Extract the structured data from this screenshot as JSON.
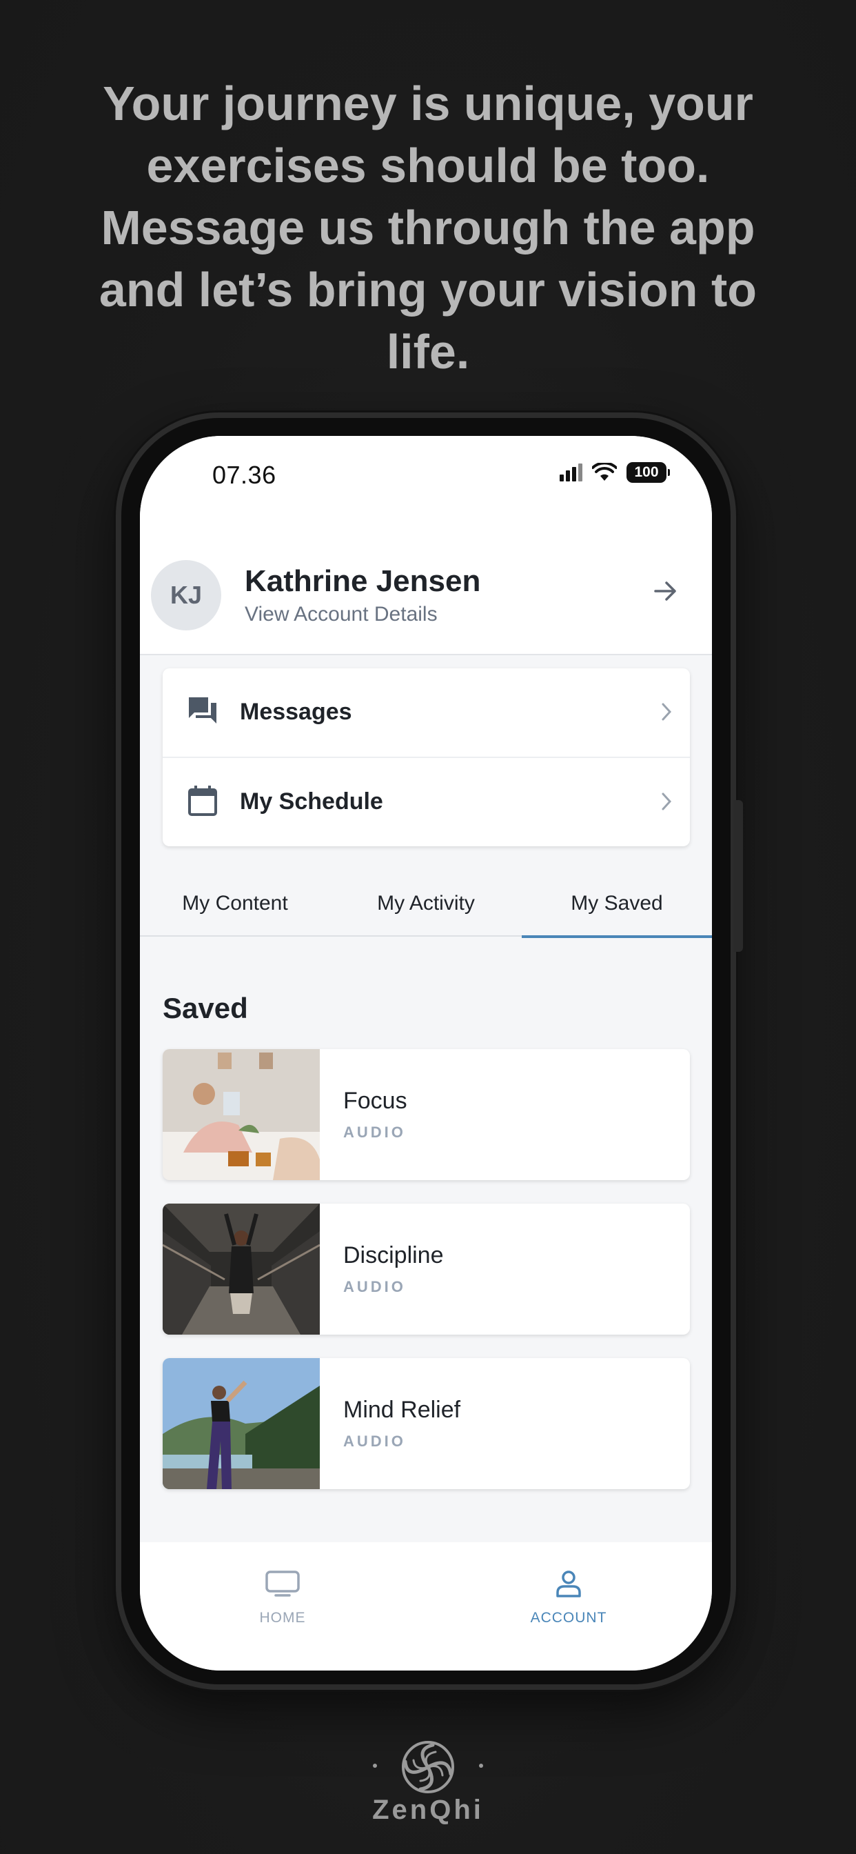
{
  "headline": "Your journey is unique, your exercises should be too. Message us through the app and let’s bring your vision to life.",
  "status_bar": {
    "time": "07.36",
    "battery": "100"
  },
  "profile": {
    "initials": "KJ",
    "name": "Kathrine Jensen",
    "subtitle": "View Account Details"
  },
  "menu": [
    {
      "label": "Messages",
      "icon": "chat-icon"
    },
    {
      "label": "My Schedule",
      "icon": "calendar-icon"
    }
  ],
  "tabs": [
    {
      "label": "My Content",
      "active": false
    },
    {
      "label": "My Activity",
      "active": false
    },
    {
      "label": "My Saved",
      "active": true
    }
  ],
  "saved": {
    "title": "Saved",
    "items": [
      {
        "name": "Focus",
        "type": "AUDIO"
      },
      {
        "name": "Discipline",
        "type": "AUDIO"
      },
      {
        "name": "Mind Relief",
        "type": "AUDIO"
      }
    ]
  },
  "bottom_nav": [
    {
      "label": "HOME",
      "icon": "tv-icon",
      "active": false
    },
    {
      "label": "ACCOUNT",
      "icon": "user-icon",
      "active": true
    }
  ],
  "colors": {
    "accent": "#4a86b8",
    "background": "#1b1b1b",
    "nav_inactive": "#9aa6b6"
  },
  "brand": "ZenQhi"
}
